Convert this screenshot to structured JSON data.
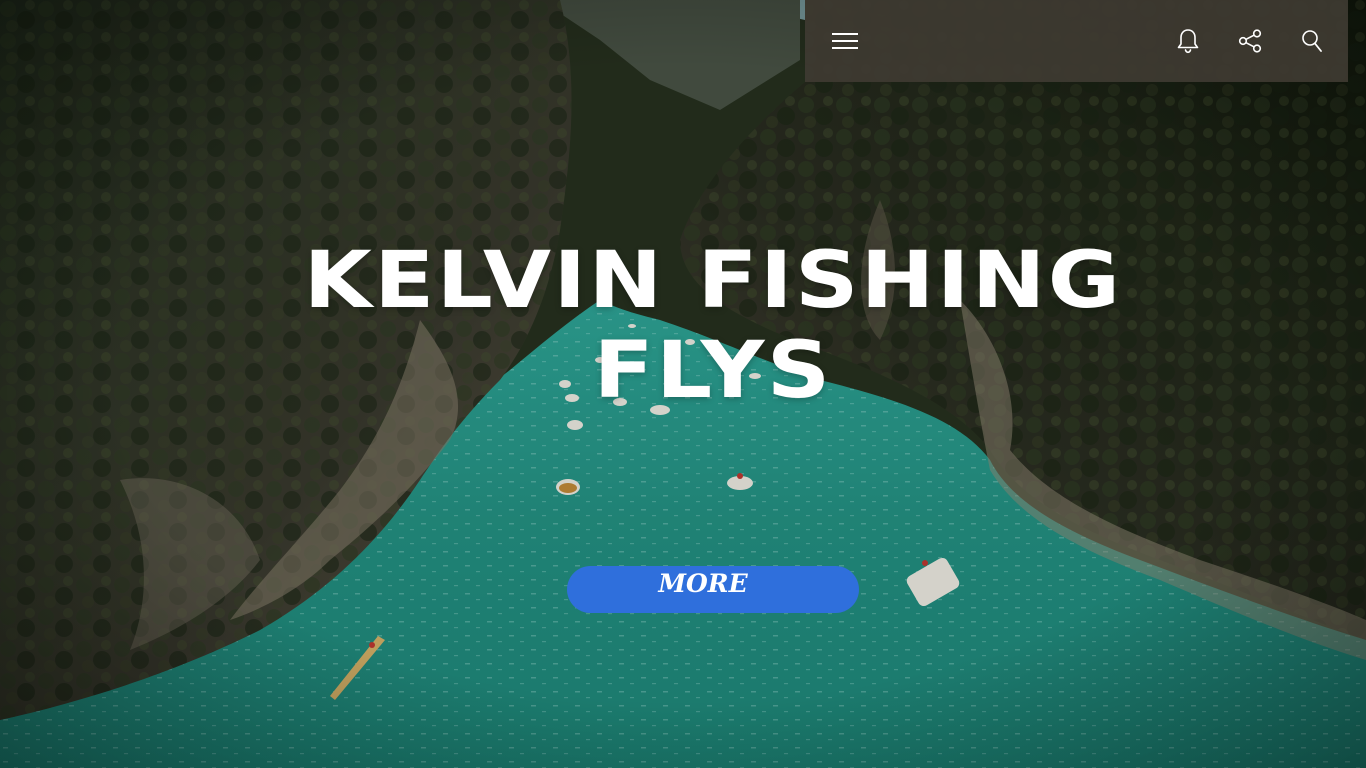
{
  "hero": {
    "title": "KELVIN FISHING FLYS",
    "button_label": "MORE"
  },
  "topbar": {
    "icons": [
      "menu-icon",
      "bell-icon",
      "share-icon",
      "search-icon"
    ]
  },
  "colors": {
    "topbar_bg": "#3e3a32",
    "button_bg": "#2f6fdc",
    "title_text": "#ffffff",
    "water": "#2a9b8c"
  }
}
